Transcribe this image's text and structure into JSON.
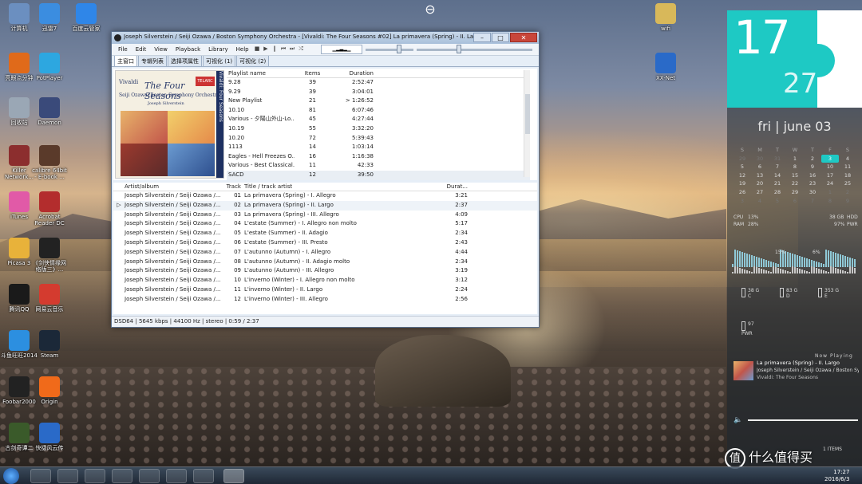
{
  "desktop": {
    "icons": [
      {
        "label": "计算机",
        "color": "#6b8fc0"
      },
      {
        "label": "迅雷7",
        "color": "#3b8de0"
      },
      {
        "label": "百度云管家",
        "color": "#2f86e8"
      },
      {
        "label": "亮眼点分钟",
        "color": "#e06a1a"
      },
      {
        "label": "PotPlayer",
        "color": "#2da7e0"
      },
      {
        "label": "回收站",
        "color": "#9aa7b5"
      },
      {
        "label": "Daemon",
        "color": "#3a4a7a"
      },
      {
        "label": "Killer Network...",
        "color": "#8c2e2e"
      },
      {
        "label": "calibre 64bit - E-book ...",
        "color": "#5a3a2a"
      },
      {
        "label": "iTunes",
        "color": "#e15aa7"
      },
      {
        "label": "Acrobat Reader DC",
        "color": "#b32d2d"
      },
      {
        "label": "Picasa 3",
        "color": "#e8b23a"
      },
      {
        "label": "《剑侠情缘网络版三》...",
        "color": "#222222"
      },
      {
        "label": "腾讯QQ",
        "color": "#1a1a1a"
      },
      {
        "label": "网易云音乐",
        "color": "#d43b2f"
      },
      {
        "label": "斗鱼旺旺2014",
        "color": "#2c8fe0"
      },
      {
        "label": "Steam",
        "color": "#1b2838"
      },
      {
        "label": "Foobar2000",
        "color": "#222222"
      },
      {
        "label": "Origin",
        "color": "#f06a1a"
      },
      {
        "label": "古剑奇谭二",
        "color": "#3a5a2a"
      },
      {
        "label": "快捷风云传",
        "color": "#2a6ac8"
      },
      {
        "label": "wifi",
        "color": "#d8b85a"
      },
      {
        "label": "XX-Net",
        "color": "#2a6ac8"
      }
    ]
  },
  "window": {
    "title": "Joseph Silverstein / Seiji Ozawa / Boston Symphony Orchestra - [Vivaldi: The Four Seasons #02] La primavera (Spring) - II. Largo  [foobar200...",
    "controls": {
      "minimize": "–",
      "maximize": "□",
      "close": "✕"
    },
    "menu": [
      "File",
      "Edit",
      "View",
      "Playback",
      "Library",
      "Help"
    ],
    "tabs": [
      "主窗口",
      "专辑列表",
      "选择项属性",
      "可视化 (1)",
      "可视化 (2)"
    ],
    "album_art": {
      "top": "Vivaldi",
      "title": "The Four Seasons",
      "label": "TELARC",
      "orchestra": "Seiji Ozawa•Boston Symphony Orchestra",
      "soloist": "Joseph Silverstein",
      "spine": "Vivaldi: Four Seasons"
    },
    "playlists": {
      "headers": [
        "Playlist name",
        "Items",
        "Duration"
      ],
      "rows": [
        [
          "9.28",
          "39",
          "2:52:47"
        ],
        [
          "9.29",
          "39",
          "3:04:01"
        ],
        [
          "New Playlist",
          "21",
          "> 1:26:52"
        ],
        [
          "10.10",
          "81",
          "6:07:46"
        ],
        [
          "Various - 夕陽山外山-Lo...",
          "45",
          "4:27:44"
        ],
        [
          "10.19",
          "55",
          "3:32:20"
        ],
        [
          "10.20",
          "72",
          "5:39:43"
        ],
        [
          "1113",
          "14",
          "1:03:14"
        ],
        [
          "Eagles - Hell Freezes O...",
          "16",
          "1:16:38"
        ],
        [
          "Various - Best Classical...",
          "11",
          "42:33"
        ],
        [
          "SACD",
          "12",
          "39:50"
        ]
      ]
    },
    "tracks": {
      "headers": [
        "Artist/album",
        "Track ...",
        "Title / track artist",
        "Durat..."
      ],
      "rows": [
        [
          "Joseph Silverstein / Seiji Ozawa /...",
          "01",
          "La primavera (Spring) - I. Allegro",
          "3:21"
        ],
        [
          "Joseph Silverstein / Seiji Ozawa /...",
          "02",
          "La primavera (Spring) - II. Largo",
          "2:37"
        ],
        [
          "Joseph Silverstein / Seiji Ozawa /...",
          "03",
          "La primavera (Spring) - III. Allegro",
          "4:09"
        ],
        [
          "Joseph Silverstein / Seiji Ozawa /...",
          "04",
          "L'estate (Summer) - I. Allegro non molto",
          "5:17"
        ],
        [
          "Joseph Silverstein / Seiji Ozawa /...",
          "05",
          "L'estate (Summer) - II. Adagio",
          "2:34"
        ],
        [
          "Joseph Silverstein / Seiji Ozawa /...",
          "06",
          "L'estate (Summer) - III. Presto",
          "2:43"
        ],
        [
          "Joseph Silverstein / Seiji Ozawa /...",
          "07",
          "L'autunno (Autumn) - I. Allegro",
          "4:44"
        ],
        [
          "Joseph Silverstein / Seiji Ozawa /...",
          "08",
          "L'autunno (Autumn) - II. Adagio molto",
          "2:34"
        ],
        [
          "Joseph Silverstein / Seiji Ozawa /...",
          "09",
          "L'autunno (Autumn) - III. Allegro",
          "3:19"
        ],
        [
          "Joseph Silverstein / Seiji Ozawa /...",
          "10",
          "L'inverno (Winter) - I. Allegro non molto",
          "3:12"
        ],
        [
          "Joseph Silverstein / Seiji Ozawa /...",
          "11",
          "L'inverno (Winter) - II. Largo",
          "2:24"
        ],
        [
          "Joseph Silverstein / Seiji Ozawa /...",
          "12",
          "L'inverno (Winter) - III. Allegro",
          "2:56"
        ]
      ],
      "playing_index": 1,
      "playing_marker": "▷"
    },
    "status": "DSD64 | 5645 kbps | 44100 Hz | stereo | 0:59 / 2:37"
  },
  "widget": {
    "hour": "17",
    "minute": "27",
    "day": "fri",
    "date": "june 03",
    "calendar": {
      "head": [
        "S",
        "M",
        "T",
        "W",
        "T",
        "F",
        "S"
      ],
      "weeks": [
        [
          "29",
          "30",
          "31",
          "1",
          "2",
          "3",
          "4"
        ],
        [
          "5",
          "6",
          "7",
          "8",
          "9",
          "10",
          "11"
        ],
        [
          "12",
          "13",
          "14",
          "15",
          "16",
          "17",
          "18"
        ],
        [
          "19",
          "20",
          "21",
          "22",
          "23",
          "24",
          "25"
        ],
        [
          "26",
          "27",
          "28",
          "29",
          "30",
          "1",
          "2"
        ],
        [
          "3",
          "4",
          "5",
          "6",
          "7",
          "8",
          "9"
        ]
      ]
    },
    "cpu_label": "CPU",
    "cpu": "13%",
    "ram_label": "RAM",
    "ram": "28%",
    "hdd_value": "38 GB",
    "hdd_label": "HDD",
    "pwr_value": "97%",
    "pwr_label": "PWR",
    "pct_a": "15%",
    "pct_b": "6%",
    "drives": [
      {
        "size": "38 G",
        "letter": "C"
      },
      {
        "size": "83 G",
        "letter": "D"
      },
      {
        "size": "353 G",
        "letter": "E"
      }
    ],
    "battery": {
      "value": "97",
      "label": "PWR"
    },
    "now_playing_label": "Now Playing",
    "np_title": "La primavera (Spring) - II. Largo",
    "np_artist": "Joseph Silverstein / Seiji Ozawa / Boston Sy...",
    "np_album": "Vivaldi: The Four Seasons",
    "items": "1 ITEMS"
  },
  "taskbar": {
    "time": "17:27",
    "date": "2016/6/3"
  },
  "watermark": {
    "mark": "值",
    "text": "什么值得买"
  }
}
